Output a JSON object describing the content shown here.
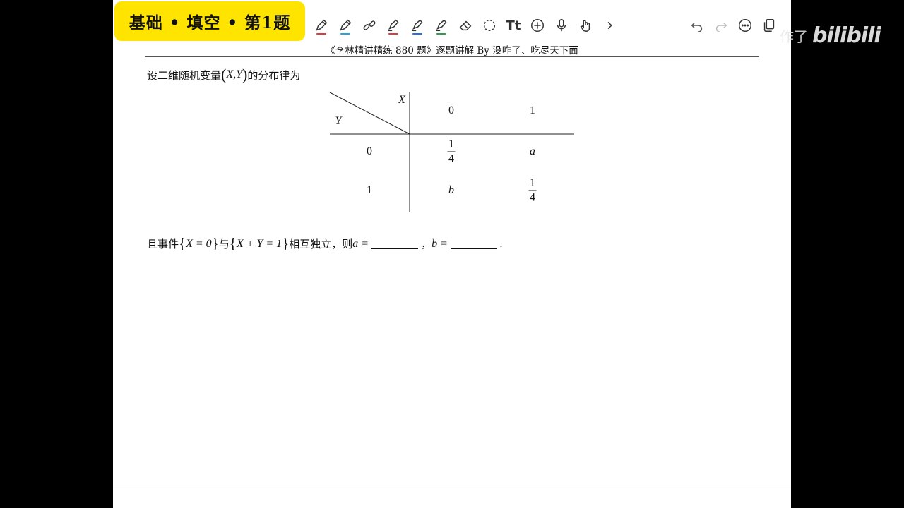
{
  "badge": {
    "text": "基础 • 填空 • 第1题"
  },
  "toolbar": {
    "tools": [
      {
        "icon": "pen-icon",
        "color": "#e03a3a"
      },
      {
        "icon": "pen-icon",
        "color": "#2aa0e0"
      },
      {
        "icon": "link-icon",
        "color": ""
      },
      {
        "icon": "highlighter-icon",
        "color": "#e03a3a"
      },
      {
        "icon": "highlighter-icon",
        "color": "#2a6fe0"
      },
      {
        "icon": "highlighter-icon",
        "color": "#2aa04a"
      },
      {
        "icon": "eraser-icon",
        "color": ""
      },
      {
        "icon": "lasso-icon",
        "color": ""
      },
      {
        "icon": "text-icon",
        "color": ""
      },
      {
        "icon": "add-icon",
        "color": ""
      },
      {
        "icon": "microphone-icon",
        "color": ""
      },
      {
        "icon": "touch-icon",
        "color": ""
      },
      {
        "icon": "chevron-right-icon",
        "color": ""
      }
    ],
    "text_tool_label": "Tt",
    "right_tools": [
      "undo-icon",
      "redo-icon",
      "more-icon",
      "pages-icon"
    ]
  },
  "overlay": {
    "username": "作了",
    "logo": "bilibili"
  },
  "document": {
    "header": "《李林精讲精练 880 题》逐题讲解 By  没咋了、吃尽天下面",
    "question_intro": "设二维随机变量",
    "question_intro_var": "X,Y",
    "question_intro_end": "的分布律为",
    "table": {
      "col_var": "X",
      "row_var": "Y",
      "col_headers": [
        "0",
        "1"
      ],
      "rows": [
        {
          "y": "0",
          "cells": [
            {
              "type": "frac",
              "num": "1",
              "den": "4"
            },
            {
              "type": "var",
              "text": "a"
            }
          ]
        },
        {
          "y": "1",
          "cells": [
            {
              "type": "var",
              "text": "b"
            },
            {
              "type": "frac",
              "num": "1",
              "den": "4"
            }
          ]
        }
      ]
    },
    "condition": {
      "prefix": "且事件",
      "event1": "X = 0",
      "mid": "与",
      "event2": "X + Y = 1",
      "suffix": "相互独立，则",
      "a_label": "a =",
      "sep": "，",
      "b_label": "b =",
      "end": "."
    }
  }
}
